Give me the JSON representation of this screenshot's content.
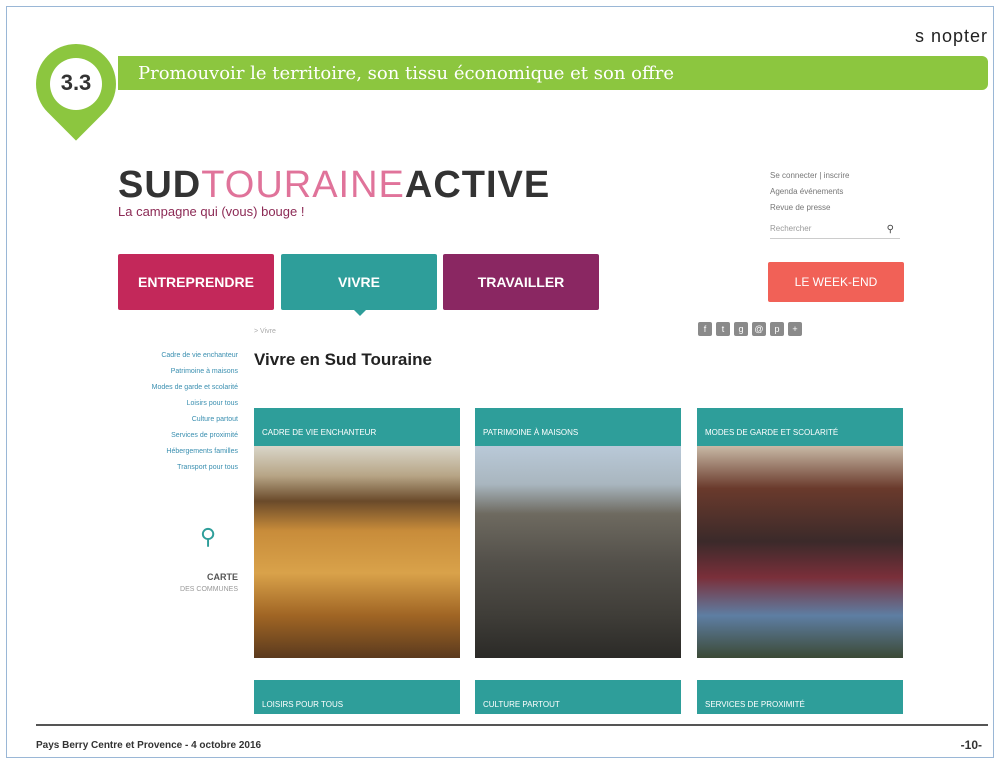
{
  "slide": {
    "brand": "s nopter",
    "section_number": "3.3",
    "section_title": "Promouvoir le territoire, son tissu économique et son offre",
    "footer_text": "Pays Berry Centre et Provence - 4 octobre 2016",
    "page_number": "-10-"
  },
  "website": {
    "logo": {
      "part1": "SUD",
      "part2": "TOURAINE",
      "part3": "ACTIVE"
    },
    "tagline": "La campagne qui (vous) bouge !",
    "utility_links": [
      "Se connecter | inscrire",
      "Agenda événements",
      "Revue de presse"
    ],
    "search_placeholder": "Rechercher",
    "nav": {
      "entreprendre": "ENTREPRENDRE",
      "vivre": "VIVRE",
      "travailler": "TRAVAILLER",
      "weekend": "LE WEEK-END"
    },
    "breadcrumb": "> Vivre",
    "page_title": "Vivre en Sud Touraine",
    "sidebar_links": [
      "Cadre de vie enchanteur",
      "Patrimoine à maisons",
      "Modes de garde et scolarité",
      "Loisirs pour tous",
      "Culture partout",
      "Services de proximité",
      "Hébergements familles",
      "Transport pour tous"
    ],
    "map": {
      "title": "CARTE",
      "subtitle": "DES COMMUNES"
    },
    "cards_top": [
      "CADRE DE VIE ENCHANTEUR",
      "PATRIMOINE À MAISONS",
      "MODES DE GARDE ET SCOLARITÉ"
    ],
    "cards_bottom": [
      "LOISIRS POUR TOUS",
      "CULTURE PARTOUT",
      "SERVICES DE PROXIMITÉ"
    ]
  },
  "colors": {
    "green_banner": "#8cc63f",
    "entreprendre": "#c3285a",
    "vivre": "#2e9e9a",
    "travailler": "#8a2762",
    "weekend": "#f16157"
  }
}
